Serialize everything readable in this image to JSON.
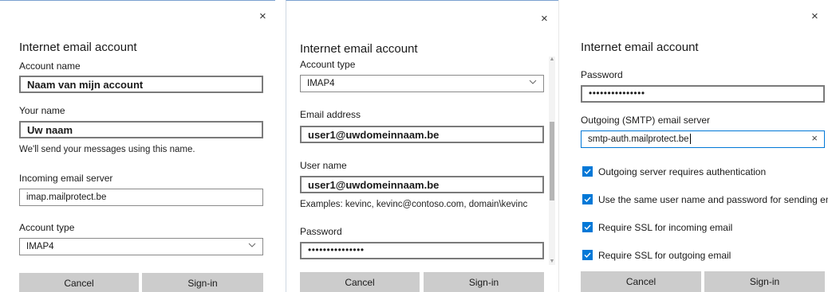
{
  "dialog_title": "Internet email account",
  "close_glyph": "×",
  "panel1": {
    "account_name_label": "Account name",
    "account_name_value": "Naam van mijn account",
    "your_name_label": "Your name",
    "your_name_value": "Uw naam",
    "your_name_hint": "We'll send your messages using this name.",
    "incoming_server_label": "Incoming email server",
    "incoming_server_value": "imap.mailprotect.be",
    "account_type_label": "Account type",
    "account_type_value": "IMAP4"
  },
  "panel2": {
    "account_type_label": "Account type",
    "account_type_value": "IMAP4",
    "email_label": "Email address",
    "email_value": "user1@uwdomeinnaam.be",
    "username_label": "User name",
    "username_value": "user1@uwdomeinnaam.be",
    "username_hint": "Examples: kevinc, kevinc@contoso.com, domain\\kevinc",
    "password_label": "Password",
    "password_value": "•••••••••••••••"
  },
  "panel3": {
    "password_label": "Password",
    "password_value": "•••••••••••••••",
    "smtp_label": "Outgoing (SMTP) email server",
    "smtp_value": "smtp-auth.mailprotect.be",
    "checkboxes": [
      {
        "label": "Outgoing server requires authentication",
        "checked": true
      },
      {
        "label": "Use the same user name and password for sending email",
        "checked": true
      },
      {
        "label": "Require SSL for incoming email",
        "checked": true
      },
      {
        "label": "Require SSL for outgoing email",
        "checked": true
      }
    ]
  },
  "buttons": {
    "cancel": "Cancel",
    "signin": "Sign-in"
  },
  "icons": {
    "close": "close-icon",
    "dropdown": "chevron-down-icon",
    "clear": "clear-icon",
    "check": "checkmark-icon"
  },
  "colors": {
    "accent": "#0078d7",
    "button_bg": "#cccccc"
  }
}
